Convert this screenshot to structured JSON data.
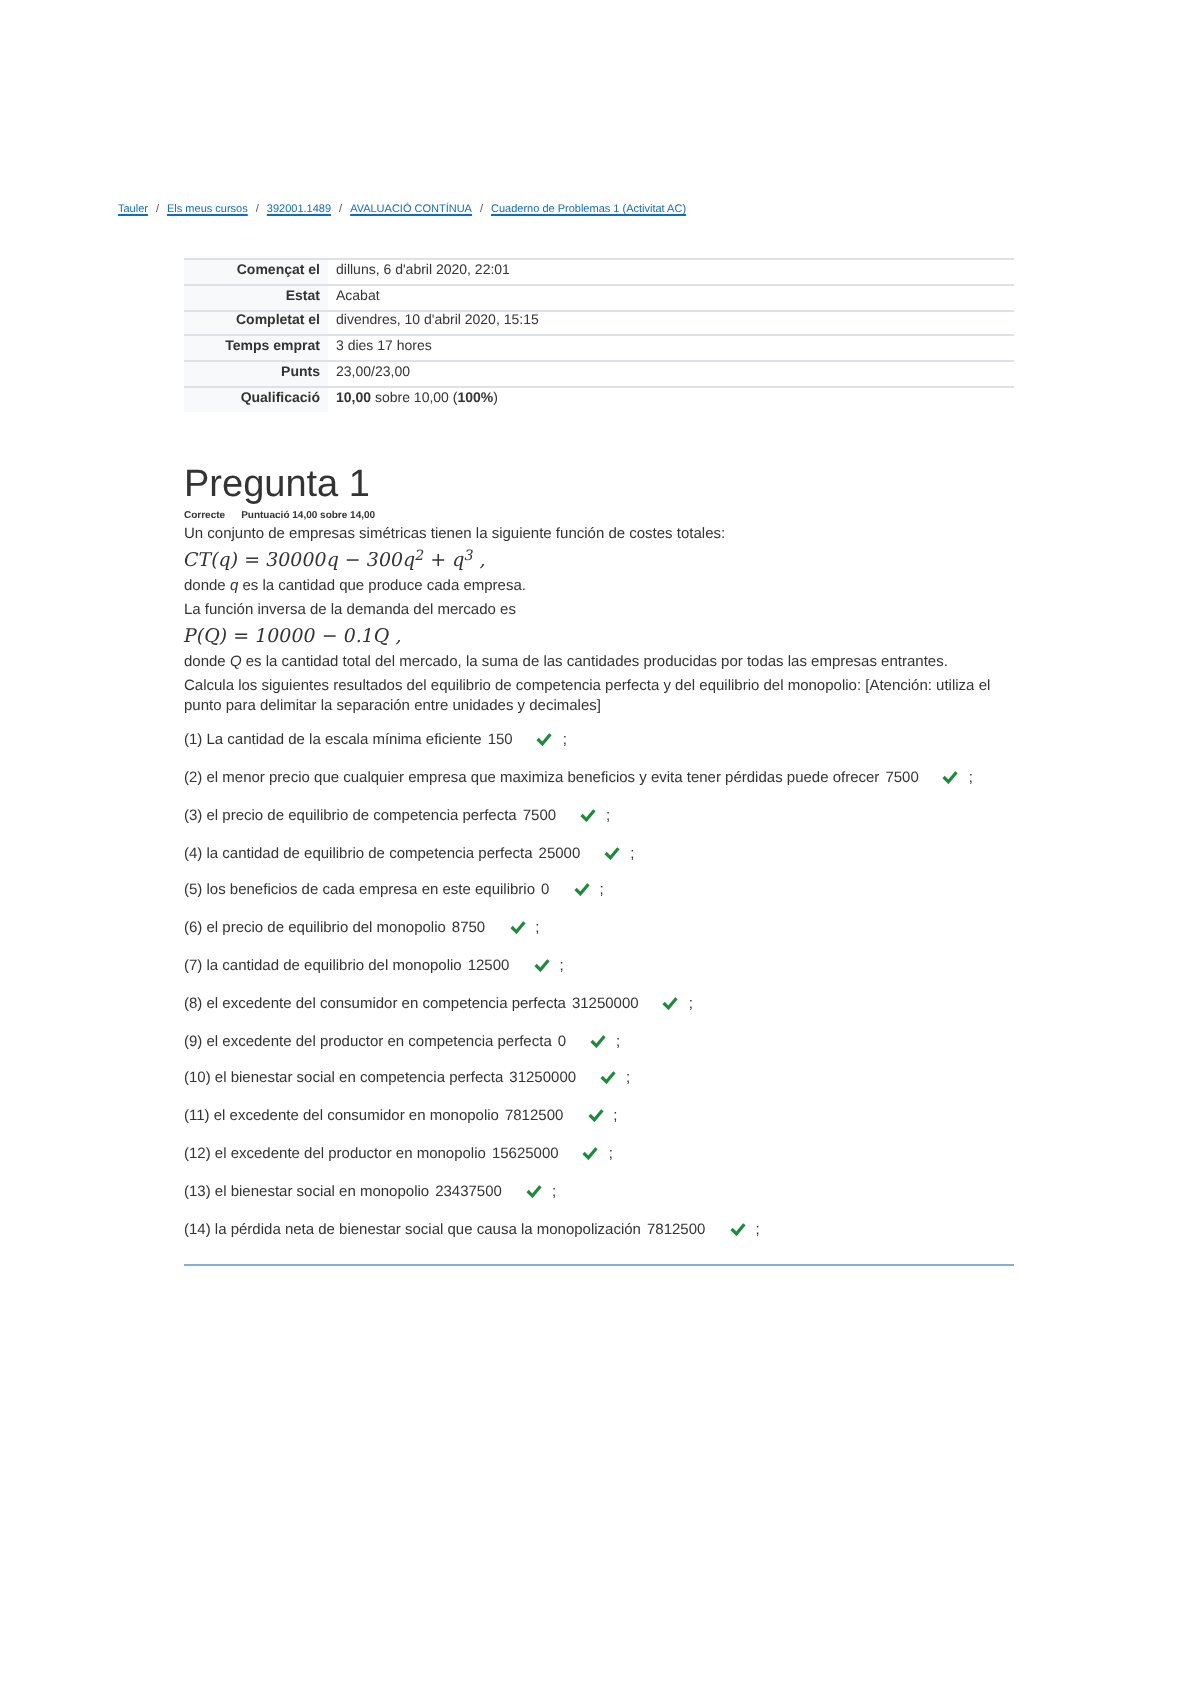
{
  "breadcrumbs": [
    "Tauler",
    "Els meus cursos",
    "392001.1489",
    "AVALUACIÓ CONTÍNUA",
    "Cuaderno de Problemas 1 (Activitat AC)"
  ],
  "breadcrumb_separator": "/",
  "summary": [
    {
      "label": "Començat el",
      "value": "dilluns, 6 d'abril 2020, 22:01"
    },
    {
      "label": "Estat",
      "value": "Acabat"
    },
    {
      "label": "Completat el",
      "value": "divendres, 10 d'abril 2020, 15:15"
    },
    {
      "label": "Temps emprat",
      "value": "3 dies 17 hores"
    },
    {
      "label": "Punts",
      "value": "23,00/23,00"
    },
    {
      "label": "Qualificació",
      "value": "**10,00** sobre 10,00 (**100%**)"
    }
  ],
  "question": {
    "title": "Pregunta 1",
    "status": "Correcte",
    "score": "Puntuació 14,00 sobre 14,00",
    "paragraphs": [
      {
        "kind": "text",
        "text": "Un conjunto de empresas simétricas tienen la siguiente función de costes totales:"
      },
      {
        "kind": "formula",
        "text": "CT(q) = 30000q − 300q$^{2}$ + q$^{3}$ ,"
      },
      {
        "kind": "text",
        "text": "donde *q* es la cantidad que produce cada empresa."
      },
      {
        "kind": "text",
        "text": "La función inversa de la demanda del mercado es"
      },
      {
        "kind": "formula",
        "text": "P(Q) = 10000 − 0.1Q ,"
      },
      {
        "kind": "text",
        "text": "donde *Q* es la cantidad total del mercado, la suma de las cantidades producidas por todas las empresas entrantes."
      },
      {
        "kind": "text",
        "text": "Calcula los siguientes resultados del equilibrio de competencia perfecta y del equilibrio del monopolio: [Atención: utiliza el punto para delimitar la separación entre unidades y decimales]"
      }
    ],
    "items": [
      {
        "text": "(1) La cantidad de la escala mínima eficiente",
        "answer": "150",
        "correct": true
      },
      {
        "text": "(2) el menor precio que cualquier empresa que maximiza beneficios y evita tener pérdidas puede ofrecer",
        "answer": "7500",
        "correct": true
      },
      {
        "text": "(3) el precio de equilibrio de competencia perfecta",
        "answer": "7500",
        "correct": true
      },
      {
        "text": "(4) la cantidad de equilibrio de competencia perfecta",
        "answer": "25000",
        "correct": true
      },
      {
        "text": "(5) los beneficios de cada empresa en este equilibrio",
        "answer": "0",
        "correct": true
      },
      {
        "text": "(6) el precio de equilibrio del monopolio",
        "answer": "8750",
        "correct": true
      },
      {
        "text": "(7) la cantidad de equilibrio del monopolio",
        "answer": "12500",
        "correct": true
      },
      {
        "text": "(8) el excedente del consumidor en competencia perfecta",
        "answer": "31250000",
        "correct": true
      },
      {
        "text": "(9) el excedente del productor en competencia perfecta",
        "answer": "0",
        "correct": true
      },
      {
        "text": "(10) el bienestar social en competencia perfecta",
        "answer": "31250000",
        "correct": true
      },
      {
        "text": "(11) el excedente del consumidor en monopolio",
        "answer": "7812500",
        "correct": true
      },
      {
        "text": "(12) el excedente del productor en monopolio",
        "answer": "15625000",
        "correct": true
      },
      {
        "text": "(13) el bienestar social en monopolio",
        "answer": "23437500",
        "correct": true
      },
      {
        "text": "(14) la pérdida neta de bienestar social que causa la monopolización",
        "answer": "7812500",
        "correct": true
      }
    ],
    "separator": ";"
  }
}
